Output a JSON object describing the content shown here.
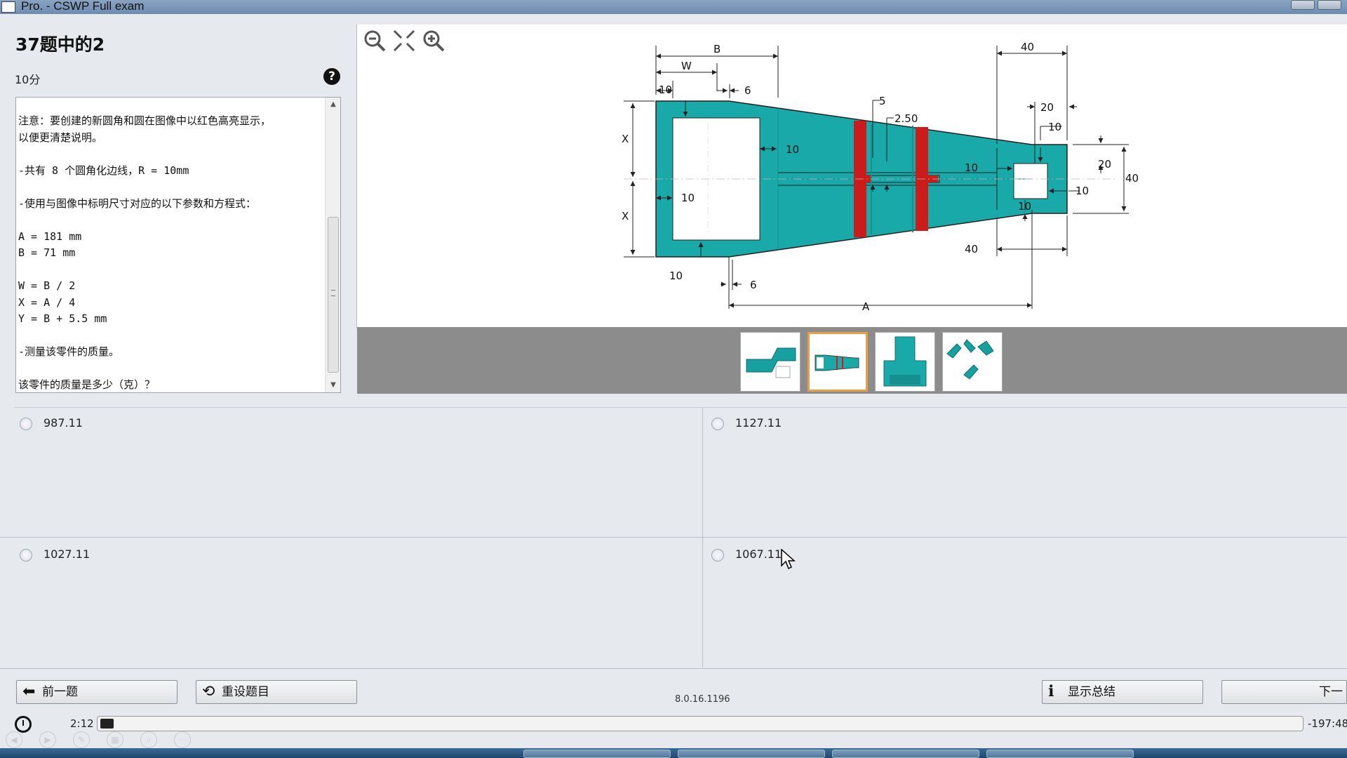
{
  "window": {
    "title": "Pro. - CSWP Full exam"
  },
  "question": {
    "title": "37题中的2",
    "points": "10分",
    "text_lines": [
      "注意：要创建的新圆角和圆在图像中以红色高亮显示，",
      "以便更清楚说明。",
      "",
      "-共有 8 个圆角化边线，R = 10mm",
      "",
      "-使用与图像中标明尺寸对应的以下参数和方程式：",
      "",
      "A = 181 mm",
      "B = 71 mm",
      "",
      "W = B / 2",
      "X = A / 4",
      "Y = B + 5.5 mm",
      "",
      "-测量该零件的质量。",
      "",
      "该零件的质量是多少（克）？"
    ]
  },
  "drawing": {
    "labels": {
      "B": "B",
      "W": "W",
      "A": "A",
      "X1": "X",
      "X2": "X",
      "d10_top": "10",
      "d6_top": "6",
      "d10_mid": "10",
      "d10_left": "10",
      "d10_bot": "10",
      "d6_bot": "6",
      "d5": "5",
      "d2_50": "2.50",
      "d40_top": "40",
      "d20_top": "20",
      "d10_tr": "10",
      "d20_right": "20",
      "d40_right": "40",
      "d10_box_l": "10",
      "d10_box_r": "10",
      "d10_box_b": "10",
      "d40_bot": "40"
    },
    "colors": {
      "part": "#1aa9a9",
      "part_dark": "#158f8f",
      "highlight": "#cc1b1b",
      "line": "#222222"
    }
  },
  "thumbnails": [
    {
      "name": "isometric-thumb",
      "selected": false
    },
    {
      "name": "top-view-thumb",
      "selected": true
    },
    {
      "name": "front-view-thumb",
      "selected": false
    },
    {
      "name": "multi-view-thumb",
      "selected": false
    }
  ],
  "answers": [
    {
      "label": "987.11"
    },
    {
      "label": "1127.11"
    },
    {
      "label": "1027.11"
    },
    {
      "label": "1067.11"
    }
  ],
  "buttons": {
    "prev": "前一题",
    "reset": "重设题目",
    "summary": "显示总结",
    "next": "下一"
  },
  "version": "8.0.16.1196",
  "timer": {
    "elapsed": "2:12",
    "remaining": "-197:48",
    "progress": 0.011
  },
  "icons": {
    "zoom_out": "zoom-out-icon",
    "fit": "fit-icon",
    "zoom_in": "zoom-in-icon",
    "help": "help-icon",
    "clock": "clock-icon"
  }
}
